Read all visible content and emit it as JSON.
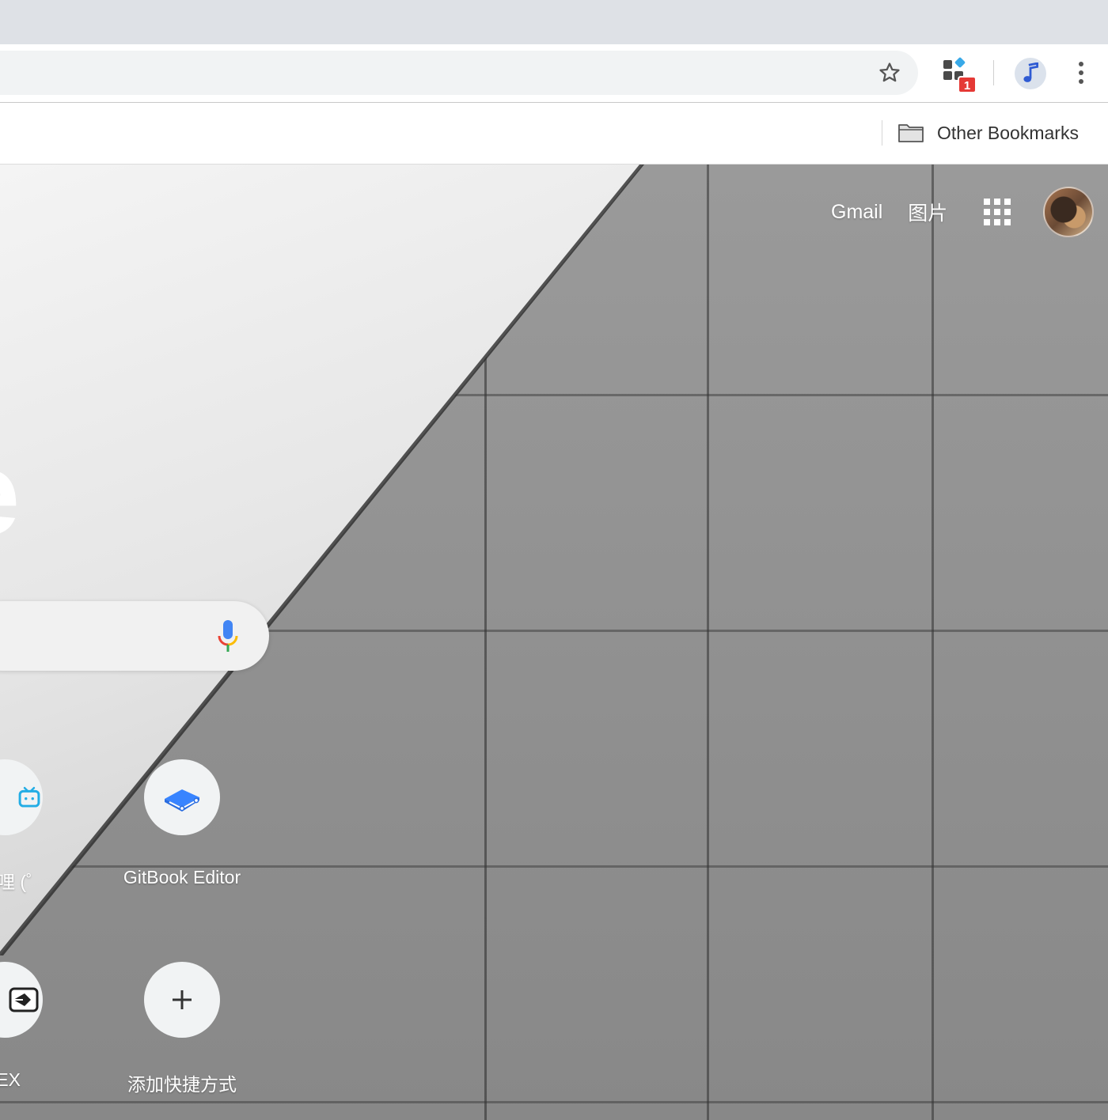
{
  "toolbar": {
    "extension_badge": "1"
  },
  "bookmarks_bar": {
    "other_bookmarks_label": "Other Bookmarks"
  },
  "ntp": {
    "top_links": [
      "Gmail",
      "图片"
    ],
    "logo_fragment": "e",
    "shortcuts": [
      {
        "label": "哔哩 (゜",
        "icon": "bilibili-tv-icon"
      },
      {
        "label": "GitBook Editor",
        "icon": "gitbook-icon"
      },
      {
        "label": "EX",
        "icon": "pen-nib-icon"
      },
      {
        "label": "添加快捷方式",
        "icon": "plus-icon"
      }
    ]
  },
  "colors": {
    "titlebar": "#dee1e6",
    "omnibox": "#f1f3f4",
    "badge": "#e53935",
    "tile_bg": "#f1f3f4",
    "gitbook_blue": "#3884ff",
    "bilibili_blue": "#23ade5"
  }
}
